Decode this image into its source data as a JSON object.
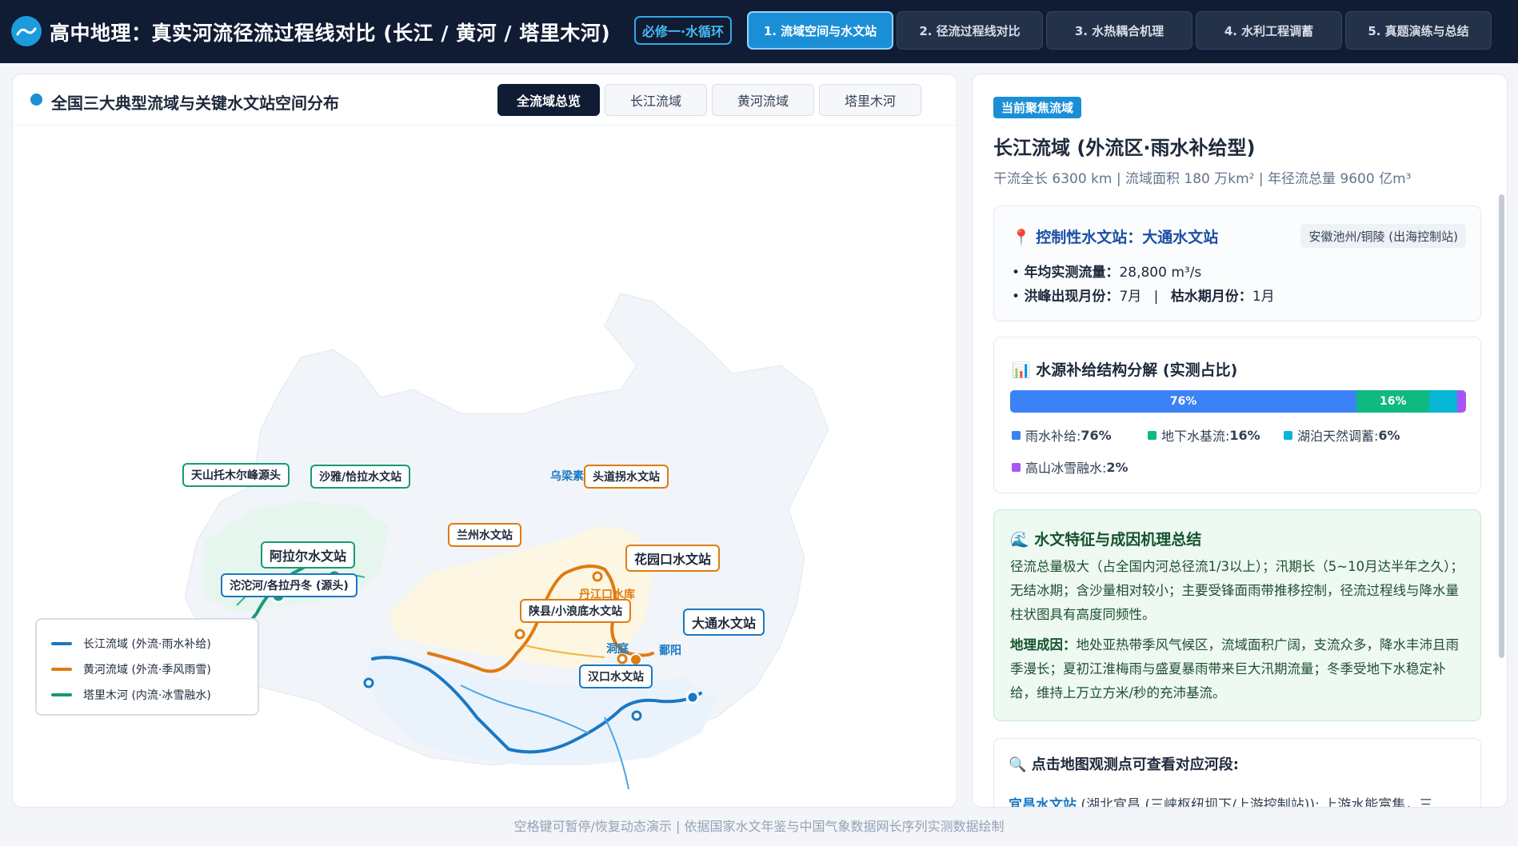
{
  "header": {
    "title": "高中地理：真实河流径流过程线对比 (长江 / 黄河 / 塔里木河)",
    "module_badge": "必修一·水循环",
    "tabs": [
      {
        "label": "1. 流域空间与水文站",
        "active": true
      },
      {
        "label": "2. 径流过程线对比",
        "active": false
      },
      {
        "label": "3. 水热耦合机理",
        "active": false
      },
      {
        "label": "4. 水利工程调蓄",
        "active": false
      },
      {
        "label": "5. 真题演练与总结",
        "active": false
      }
    ]
  },
  "map": {
    "title": "全国三大典型流域与关键水文站空间分布",
    "tabs": [
      {
        "label": "全流域总览",
        "active": true
      },
      {
        "label": "长江流域",
        "active": false
      },
      {
        "label": "黄河流域",
        "active": false
      },
      {
        "label": "塔里木河",
        "active": false
      }
    ],
    "labels": {
      "tianshan": "天山托木尔峰源头",
      "shaya": "沙雅/恰拉水文站",
      "alar": "阿拉尔水文站",
      "tuotuo": "沱沱河/各拉丹冬 (源头)",
      "lanzhou": "兰州水文站",
      "toudaoguai": "头道拐水文站",
      "huayuankou": "花园口水文站",
      "shanxian": "陕县/小浪底水文站",
      "datong": "大通水文站",
      "hankou": "汉口水文站"
    },
    "float_text": {
      "wuliangsu": "乌梁素",
      "danjiangkou": "丹江口水库",
      "dongting": "洞庭",
      "poyang": "鄱阳"
    },
    "legend": [
      {
        "label": "长江流域 (外流·雨水补给)",
        "color": "#1a78c2"
      },
      {
        "label": "黄河流域 (外流·季风雨雪)",
        "color": "#e07b12"
      },
      {
        "label": "塔里木河 (内流·冰雪融水)",
        "color": "#179a76"
      }
    ]
  },
  "detail": {
    "focus_badge": "当前聚焦流域",
    "basin_name": "长江流域 (外流区·雨水补给型)",
    "basin_stats": "干流全长 6300 km  |  流域面积 180 万km²  |  年径流总量 9600 亿m³",
    "station": {
      "title": "控制性水文站：大通水文站",
      "location": "安徽池州/铜陵 (出海控制站)",
      "flow_label": "年均实测流量：",
      "flow_value": "28,800 m³/s",
      "peak_label": "洪峰出现月份：",
      "peak_value": "7月",
      "low_label": "枯水期月份：",
      "low_value": "1月",
      "sep": "|"
    },
    "source": {
      "title": "水源补给结构分解 (实测占比)",
      "segments": [
        {
          "name": "雨水补给",
          "value": 76,
          "text": "76%",
          "color": "#3b82f6"
        },
        {
          "name": "地下水基流",
          "value": 16,
          "text": "16%",
          "color": "#10b981"
        },
        {
          "name": "湖泊天然调蓄",
          "value": 6,
          "text": "6%",
          "color": "#06b6d4"
        },
        {
          "name": "高山冰雪融水",
          "value": 2,
          "text": "2%",
          "color": "#a855f7"
        }
      ],
      "legend_text": [
        {
          "label": "雨水补给: ",
          "value": "76%"
        },
        {
          "label": "地下水基流: ",
          "value": "16%"
        },
        {
          "label": "湖泊天然调蓄: ",
          "value": "6%"
        },
        {
          "label": "高山冰雪融水: ",
          "value": "2%"
        }
      ]
    },
    "summary": {
      "title": "水文特征与成因机理总结",
      "p1": "径流总量极大（占全国内河总径流1/3以上）；汛期长（5~10月达半年之久）；无结冰期；含沙量相对较小；主要受锋面雨带推移控制，径流过程线与降水量柱状图具有高度同频性。",
      "p2_label": "地理成因：",
      "p2": "地处亚热带季风气候区，流域面积广阔，支流众多，降水丰沛且雨季漫长；夏初江淮梅雨与盛夏暴雨带来巨大汛期流量；冬季受地下水稳定补给，维持上万立方米/秒的充沛基流。"
    },
    "click": {
      "title": "点击地图观测点可查看对应河段:",
      "station_name": "宜昌水文站",
      "station_desc": " (湖北宜昌 (三峡枢纽坝下/上游控制站)): 上游水能富集，三"
    }
  },
  "footer": "空格键可暂停/恢复动态演示  |  依据国家水文年鉴与中国气象数据网长序列实测数据绘制"
}
